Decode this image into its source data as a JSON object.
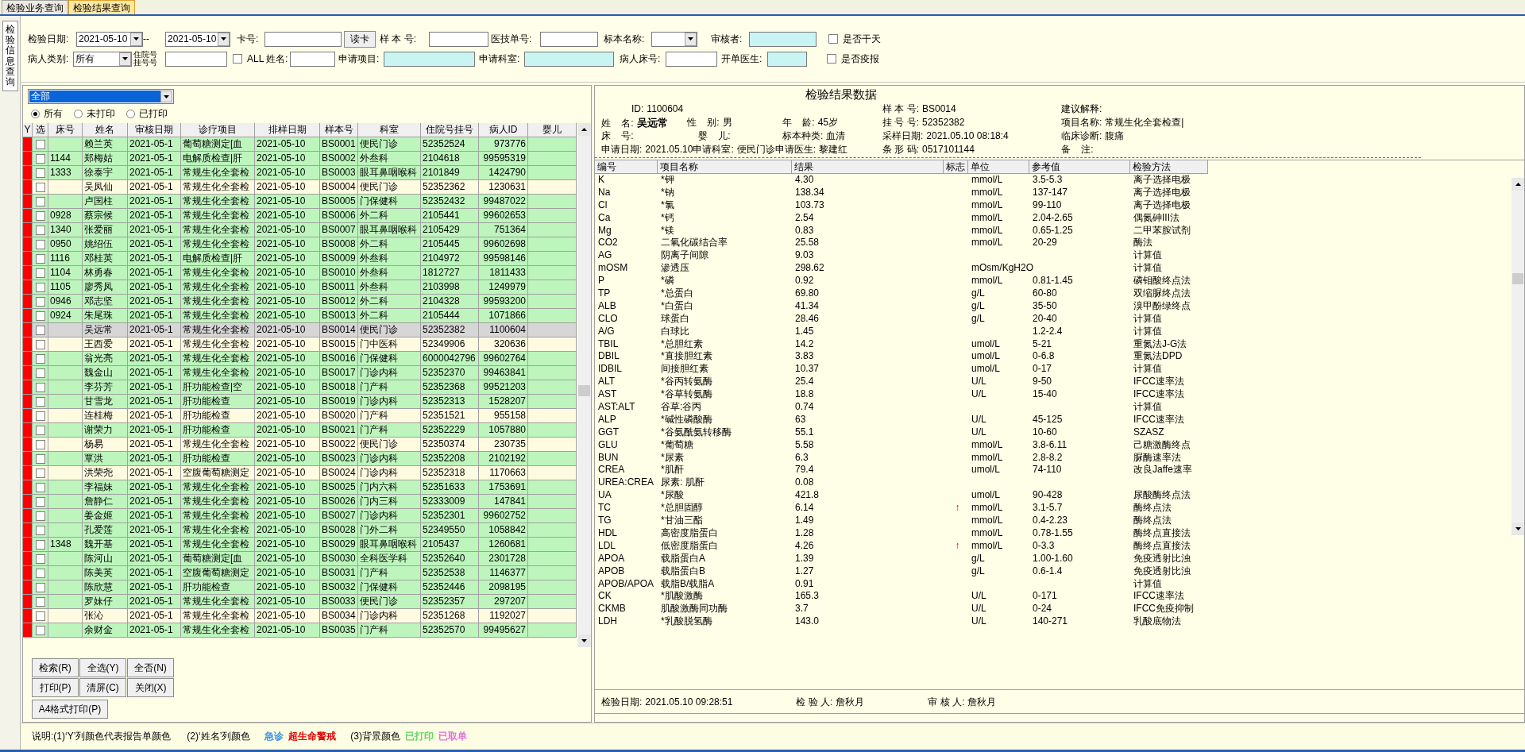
{
  "tabs": [
    {
      "label": "检验业务查询",
      "selected": false
    },
    {
      "label": "检验结果查询",
      "selected": true
    }
  ],
  "side_tab": {
    "label": "检验信息查询",
    "selected": true
  },
  "filters": {
    "row_1": [
      {
        "kind": "label",
        "text": "检验日期:"
      },
      {
        "kind": "dropdown",
        "value": "2021-05-10"
      },
      {
        "kind": "label",
        "text": "--"
      },
      {
        "kind": "dropdown",
        "value": "2021-05-10"
      },
      {
        "kind": "label",
        "text": "卡号:"
      },
      {
        "kind": "input",
        "highlighted": false
      },
      {
        "kind": "button",
        "text": "读卡"
      },
      {
        "kind": "label",
        "text": "样 本 号:"
      },
      {
        "kind": "input",
        "highlighted": false
      },
      {
        "kind": "label",
        "text": "医技单号:"
      },
      {
        "kind": "input",
        "highlighted": false
      },
      {
        "kind": "label",
        "text": "标本名称:"
      },
      {
        "kind": "dropdown"
      },
      {
        "kind": "label",
        "text": "审核者:"
      },
      {
        "kind": "input",
        "highlighted": true
      },
      {
        "kind": "checkbox",
        "text": "是否干天",
        "checked": false
      }
    ],
    "row_2": [
      {
        "kind": "label",
        "text": "病人类别:"
      },
      {
        "kind": "dropdown",
        "value": "所有"
      },
      {
        "kind": "stacked_label",
        "lines": [
          "住院号",
          "挂号号"
        ]
      },
      {
        "kind": "input",
        "highlighted": false
      },
      {
        "kind": "checkbox",
        "text": "ALL",
        "checked": false
      },
      {
        "kind": "label",
        "text": "姓名:"
      },
      {
        "kind": "input",
        "highlighted": false
      },
      {
        "kind": "label",
        "text": "申请项目:"
      },
      {
        "kind": "input",
        "highlighted": true
      },
      {
        "kind": "label",
        "text": "申请科室:"
      },
      {
        "kind": "input",
        "highlighted": true
      },
      {
        "kind": "label",
        "text": "病人床号:"
      },
      {
        "kind": "input",
        "highlighted": false
      },
      {
        "kind": "label",
        "text": "开单医生:"
      },
      {
        "kind": "input",
        "highlighted": true
      },
      {
        "kind": "checkbox",
        "text": "是否疫报",
        "checked": false
      }
    ]
  },
  "list_panel": {
    "filter_dropdown": {
      "value": "全部"
    },
    "print_filter": [
      {
        "label": "所有",
        "selected": true
      },
      {
        "label": "未打印",
        "selected": false
      },
      {
        "label": "已打印",
        "selected": false
      }
    ],
    "columns": [
      "Y",
      "选",
      "床号",
      "姓名",
      "审核日期",
      "诊疗项目",
      "排样日期",
      "样本号",
      "科室",
      "住院号挂号",
      "病人ID",
      "婴儿"
    ],
    "rows": [
      {
        "color": "#ff0000",
        "checked": false,
        "printed": true,
        "selected": false,
        "name": "赖兰英",
        "audit": "2021-05-1",
        "item": "葡萄糖测定[血",
        "sorted": "2021-05-10",
        "sample": "BS0001",
        "dept": "便民门诊",
        "reg": "52352524",
        "pid": "973776"
      },
      {
        "color": "#ff0000",
        "checked": false,
        "printed": true,
        "selected": false,
        "bed": "1144",
        "name": "郑梅姑",
        "audit": "2021-05-1",
        "item": "电解质检查|肝",
        "sorted": "2021-05-10",
        "sample": "BS0002",
        "dept": "外叁科",
        "reg": "2104618",
        "pid": "99595319"
      },
      {
        "color": "#ff0000",
        "checked": false,
        "printed": true,
        "selected": false,
        "bed": "1333",
        "name": "徐泰宇",
        "audit": "2021-05-1",
        "item": "常规生化全套检",
        "sorted": "2021-05-10",
        "sample": "BS0003",
        "dept": "眼耳鼻咽喉科",
        "reg": "2101849",
        "pid": "1424790"
      },
      {
        "color": "#ff0000",
        "checked": false,
        "printed": false,
        "selected": false,
        "name": "吴凤仙",
        "audit": "2021-05-1",
        "item": "常规生化全套检",
        "sorted": "2021-05-10",
        "sample": "BS0004",
        "dept": "便民门诊",
        "reg": "52352362",
        "pid": "1230631"
      },
      {
        "color": "#ff0000",
        "checked": false,
        "printed": true,
        "selected": false,
        "name": "卢国柱",
        "audit": "2021-05-1",
        "item": "常规生化全套检",
        "sorted": "2021-05-10",
        "sample": "BS0005",
        "dept": "门保健科",
        "reg": "52352432",
        "pid": "99487022"
      },
      {
        "color": "#ff0000",
        "checked": false,
        "printed": true,
        "selected": false,
        "bed": "0928",
        "name": "蔡宗候",
        "audit": "2021-05-1",
        "item": "常规生化全套检",
        "sorted": "2021-05-10",
        "sample": "BS0006",
        "dept": "外二科",
        "reg": "2105441",
        "pid": "99602653"
      },
      {
        "color": "#ff0000",
        "checked": false,
        "printed": true,
        "selected": false,
        "bed": "1340",
        "name": "张爱丽",
        "audit": "2021-05-1",
        "item": "常规生化全套检",
        "sorted": "2021-05-10",
        "sample": "BS0007",
        "dept": "眼耳鼻咽喉科",
        "reg": "2105429",
        "pid": "751364"
      },
      {
        "color": "#ff0000",
        "checked": false,
        "printed": true,
        "selected": false,
        "bed": "0950",
        "name": "姚绍伍",
        "audit": "2021-05-1",
        "item": "常规生化全套检",
        "sorted": "2021-05-10",
        "sample": "BS0008",
        "dept": "外二科",
        "reg": "2105445",
        "pid": "99602698"
      },
      {
        "color": "#ff0000",
        "checked": false,
        "printed": true,
        "selected": false,
        "bed": "1116",
        "name": "邓桂英",
        "audit": "2021-05-1",
        "item": "电解质检查|肝",
        "sorted": "2021-05-10",
        "sample": "BS0009",
        "dept": "外叁科",
        "reg": "2104972",
        "pid": "99598146"
      },
      {
        "color": "#ff0000",
        "checked": false,
        "printed": true,
        "selected": false,
        "bed": "1104",
        "name": "林勇春",
        "audit": "2021-05-1",
        "item": "常规生化全套检",
        "sorted": "2021-05-10",
        "sample": "BS0010",
        "dept": "外叁科",
        "reg": "1812727",
        "pid": "1811433"
      },
      {
        "color": "#ff0000",
        "checked": false,
        "printed": true,
        "selected": false,
        "bed": "1105",
        "name": "廖秀凤",
        "audit": "2021-05-1",
        "item": "常规生化全套检",
        "sorted": "2021-05-10",
        "sample": "BS0011",
        "dept": "外叁科",
        "reg": "2103998",
        "pid": "1249979"
      },
      {
        "color": "#ff0000",
        "checked": false,
        "printed": true,
        "selected": false,
        "bed": "0946",
        "name": "邓志坚",
        "audit": "2021-05-1",
        "item": "常规生化全套检",
        "sorted": "2021-05-10",
        "sample": "BS0012",
        "dept": "外二科",
        "reg": "2104328",
        "pid": "99593200"
      },
      {
        "color": "#ff0000",
        "checked": false,
        "printed": true,
        "selected": false,
        "bed": "0924",
        "name": "朱尾珠",
        "audit": "2021-05-1",
        "item": "常规生化全套检",
        "sorted": "2021-05-10",
        "sample": "BS0013",
        "dept": "外二科",
        "reg": "2105444",
        "pid": "1071866"
      },
      {
        "color": "#ff0000",
        "checked": false,
        "selected": true,
        "name": "吴远常",
        "audit": "2021-05-1",
        "item": "常规生化全套检",
        "sorted": "2021-05-10",
        "sample": "BS0014",
        "dept": "便民门诊",
        "reg": "52352382",
        "pid": "1100604"
      },
      {
        "color": "#ff0000",
        "checked": false,
        "printed": false,
        "selected": false,
        "name": "王西爱",
        "audit": "2021-05-1",
        "item": "常规生化全套检",
        "sorted": "2021-05-10",
        "sample": "BS0015",
        "dept": "门中医科",
        "reg": "52349906",
        "pid": "320636"
      },
      {
        "color": "#ff0000",
        "checked": false,
        "printed": true,
        "selected": false,
        "name": "翁光亮",
        "audit": "2021-05-1",
        "item": "常规生化全套检",
        "sorted": "2021-05-10",
        "sample": "BS0016",
        "dept": "门保健科",
        "reg": "6000042796",
        "pid": "99602764"
      },
      {
        "color": "#ff0000",
        "checked": false,
        "printed": true,
        "selected": false,
        "name": "魏金山",
        "audit": "2021-05-1",
        "item": "常规生化全套检",
        "sorted": "2021-05-10",
        "sample": "BS0017",
        "dept": "门诊内科",
        "reg": "52352370",
        "pid": "99463841"
      },
      {
        "color": "#ff0000",
        "checked": false,
        "printed": true,
        "selected": false,
        "name": "李芬芳",
        "audit": "2021-05-1",
        "item": "肝功能检查|空",
        "sorted": "2021-05-10",
        "sample": "BS0018",
        "dept": "门产科",
        "reg": "52352368",
        "pid": "99521203"
      },
      {
        "color": "#ff0000",
        "checked": false,
        "printed": true,
        "selected": false,
        "name": "甘雪龙",
        "audit": "2021-05-1",
        "item": "肝功能检查",
        "sorted": "2021-05-10",
        "sample": "BS0019",
        "dept": "门诊内科",
        "reg": "52352313",
        "pid": "1528207"
      },
      {
        "color": "#ff0000",
        "checked": false,
        "printed": false,
        "selected": false,
        "name": "连桂梅",
        "audit": "2021-05-1",
        "item": "肝功能检查",
        "sorted": "2021-05-10",
        "sample": "BS0020",
        "dept": "门产科",
        "reg": "52351521",
        "pid": "955158"
      },
      {
        "color": "#ff0000",
        "checked": false,
        "printed": true,
        "selected": false,
        "name": "谢荣力",
        "audit": "2021-05-1",
        "item": "肝功能检查",
        "sorted": "2021-05-10",
        "sample": "BS0021",
        "dept": "门产科",
        "reg": "52352229",
        "pid": "1057880"
      },
      {
        "color": "#ff0000",
        "checked": false,
        "printed": false,
        "selected": false,
        "name": "杨易",
        "audit": "2021-05-1",
        "item": "常规生化全套检",
        "sorted": "2021-05-10",
        "sample": "BS0022",
        "dept": "便民门诊",
        "reg": "52350374",
        "pid": "230735"
      },
      {
        "color": "#ff0000",
        "checked": false,
        "printed": true,
        "selected": false,
        "name": "覃洪",
        "audit": "2021-05-1",
        "item": "肝功能检查",
        "sorted": "2021-05-10",
        "sample": "BS0023",
        "dept": "门诊内科",
        "reg": "52352208",
        "pid": "2102192"
      },
      {
        "color": "#ff0000",
        "checked": false,
        "printed": false,
        "selected": false,
        "name": "洪荣尧",
        "audit": "2021-05-1",
        "item": "空腹葡萄糖测定",
        "sorted": "2021-05-10",
        "sample": "BS0024",
        "dept": "门诊内科",
        "reg": "52352318",
        "pid": "1170663"
      },
      {
        "color": "#ff0000",
        "checked": false,
        "printed": true,
        "selected": false,
        "name": "李福妹",
        "audit": "2021-05-1",
        "item": "常规生化全套检",
        "sorted": "2021-05-10",
        "sample": "BS0025",
        "dept": "门内六科",
        "reg": "52351633",
        "pid": "1753691"
      },
      {
        "color": "#ff0000",
        "checked": false,
        "printed": true,
        "selected": false,
        "name": "詹静仁",
        "audit": "2021-05-1",
        "item": "常规生化全套检",
        "sorted": "2021-05-10",
        "sample": "BS0026",
        "dept": "门内三科",
        "reg": "52333009",
        "pid": "147841"
      },
      {
        "color": "#ff0000",
        "checked": false,
        "printed": true,
        "selected": false,
        "name": "姜金姬",
        "audit": "2021-05-1",
        "item": "常规生化全套检",
        "sorted": "2021-05-10",
        "sample": "BS0027",
        "dept": "门诊内科",
        "reg": "52352301",
        "pid": "99602752"
      },
      {
        "color": "#ff0000",
        "checked": false,
        "printed": true,
        "selected": false,
        "name": "孔爱莲",
        "audit": "2021-05-1",
        "item": "常规生化全套检",
        "sorted": "2021-05-10",
        "sample": "BS0028",
        "dept": "门外二科",
        "reg": "52349550",
        "pid": "1058842"
      },
      {
        "color": "#ff0000",
        "checked": false,
        "printed": true,
        "selected": false,
        "bed": "1348",
        "name": "魏开基",
        "audit": "2021-05-1",
        "item": "常规生化全套检",
        "sorted": "2021-05-10",
        "sample": "BS0029",
        "dept": "眼耳鼻咽喉科",
        "reg": "2105437",
        "pid": "1260681"
      },
      {
        "color": "#ff0000",
        "checked": false,
        "printed": true,
        "selected": false,
        "name": "陈河山",
        "audit": "2021-05-1",
        "item": "葡萄糖测定[血",
        "sorted": "2021-05-10",
        "sample": "BS0030",
        "dept": "全科医学科",
        "reg": "52352640",
        "pid": "2301728"
      },
      {
        "color": "#ff0000",
        "checked": false,
        "printed": true,
        "selected": false,
        "name": "陈美英",
        "audit": "2021-05-1",
        "item": "空腹葡萄糖测定",
        "sorted": "2021-05-10",
        "sample": "BS0031",
        "dept": "门产科",
        "reg": "52352538",
        "pid": "1146377"
      },
      {
        "color": "#ff0000",
        "checked": false,
        "printed": true,
        "selected": false,
        "name": "陈欣慧",
        "audit": "2021-05-1",
        "item": "肝功能检查",
        "sorted": "2021-05-10",
        "sample": "BS0032",
        "dept": "门保健科",
        "reg": "52352446",
        "pid": "2098195"
      },
      {
        "color": "#ff0000",
        "checked": false,
        "printed": true,
        "selected": false,
        "name": "罗妹仔",
        "audit": "2021-05-1",
        "item": "常规生化全套检",
        "sorted": "2021-05-10",
        "sample": "BS0033",
        "dept": "便民门诊",
        "reg": "52352357",
        "pid": "297207"
      },
      {
        "color": "#ff0000",
        "checked": false,
        "printed": false,
        "selected": false,
        "name": "张沁",
        "audit": "2021-05-1",
        "item": "常规生化全套检",
        "sorted": "2021-05-10",
        "sample": "BS0034",
        "dept": "门诊内科",
        "reg": "52351268",
        "pid": "1192027"
      },
      {
        "color": "#ff0000",
        "checked": false,
        "printed": true,
        "selected": false,
        "name": "余财金",
        "audit": "2021-05-1",
        "item": "常规生化全套检",
        "sorted": "2021-05-10",
        "sample": "BS0035",
        "dept": "门产科",
        "reg": "52352570",
        "pid": "99495627"
      }
    ],
    "buttons": [
      "检索(R)",
      "全选(Y)",
      "全否(N)",
      "打印(P)",
      "清屏(C)",
      "关闭(X)",
      "A4格式打印(P)"
    ]
  },
  "legend": [
    {
      "text": "说明:(1)‘Y’列颜色代表报告单颜色"
    },
    {
      "text": "(2)‘姓名’列颜色"
    },
    {
      "text": "急诊",
      "color": "#3a8ee6"
    },
    {
      "text": "超生命警戒",
      "color": "#e00000"
    },
    {
      "text": "(3)背景颜色"
    },
    {
      "text": "已打印",
      "color": "#5ed85e"
    },
    {
      "text": "已取单",
      "color": "#e070e0"
    }
  ],
  "result_panel": {
    "title": "检验结果数据",
    "info_left": [
      [
        {
          "label": "ID:",
          "value": "1100604"
        }
      ],
      [
        {
          "label": "姓    名:",
          "value": "吴远常"
        },
        {
          "label": "性    别:",
          "value": "男"
        },
        {
          "label": "年    龄:",
          "value": "45岁"
        }
      ],
      [
        {
          "label": "床    号:"
        },
        {
          "label": "婴    儿:"
        },
        {
          "label": "标本种类:",
          "value": "血清"
        }
      ],
      [
        {
          "label": "申请日期:",
          "value": "2021.05.10"
        },
        {
          "label": "申请科室:",
          "value": "便民门诊"
        },
        {
          "label": "申请医生:",
          "value": "黎建红"
        }
      ]
    ],
    "info_middle": [
      {
        "label": "样 本 号:",
        "value": "BS0014"
      },
      {
        "label": "挂 号 号:",
        "value": "52352382"
      },
      {
        "label": "采样日期:",
        "value": "2021.05.10 08:18:4"
      },
      {
        "label": "条 形 码:",
        "value": "0517101144"
      }
    ],
    "info_right": [
      {
        "label": "建议解释:"
      },
      {
        "label": "项目名称:",
        "value": "常规生化全套检查|"
      },
      {
        "label": "临床诊断:",
        "value": "腹痛"
      },
      {
        "label": "备    注:"
      }
    ],
    "columns": [
      "编号",
      "项目名称",
      "结果",
      "标志",
      "单位",
      "参考值",
      "检验方法"
    ],
    "rows": [
      {
        "code": "K",
        "name": "*钾",
        "result": "4.30",
        "unit": "mmol/L",
        "ref": "3.5-5.3",
        "method": "离子选择电极"
      },
      {
        "code": "Na",
        "name": "*钠",
        "result": "138.34",
        "unit": "mmol/L",
        "ref": "137-147",
        "method": "离子选择电极"
      },
      {
        "code": "Cl",
        "name": "*氯",
        "result": "103.73",
        "unit": "mmol/L",
        "ref": "99-110",
        "method": "离子选择电极"
      },
      {
        "code": "Ca",
        "name": "*钙",
        "result": "2.54",
        "unit": "mmol/L",
        "ref": "2.04-2.65",
        "method": "偶氮砷III法"
      },
      {
        "code": "Mg",
        "name": "*镁",
        "result": "0.83",
        "unit": "mmol/L",
        "ref": "0.65-1.25",
        "method": "二甲苯胺试剂"
      },
      {
        "code": "CO2",
        "name": "二氧化碳结合率",
        "result": "25.58",
        "unit": "mmol/L",
        "ref": "20-29",
        "method": "酶法"
      },
      {
        "code": "AG",
        "name": "阴离子间隙",
        "result": "9.03",
        "method": "计算值"
      },
      {
        "code": "mOSM",
        "name": "渗透压",
        "result": "298.62",
        "unit": "mOsm/KgH2O",
        "method": "计算值"
      },
      {
        "code": "P",
        "name": "*磷",
        "result": "0.92",
        "unit": "mmol/L",
        "ref": "0.81-1.45",
        "method": "磷钼酸终点法"
      },
      {
        "code": "TP",
        "name": "*总蛋白",
        "result": "69.80",
        "unit": "g/L",
        "ref": "60-80",
        "method": "双缩脲终点法"
      },
      {
        "code": "ALB",
        "name": "*白蛋白",
        "result": "41.34",
        "unit": "g/L",
        "ref": "35-50",
        "method": "溴甲酚绿终点"
      },
      {
        "code": "CLO",
        "name": "球蛋白",
        "result": "28.46",
        "unit": "g/L",
        "ref": "20-40",
        "method": "计算值"
      },
      {
        "code": "A/G",
        "name": "白球比",
        "result": "1.45",
        "ref": "1.2-2.4",
        "method": "计算值"
      },
      {
        "code": "TBIL",
        "name": "*总胆红素",
        "result": "14.2",
        "unit": "umol/L",
        "ref": "5-21",
        "method": "重氮法J-G法"
      },
      {
        "code": "DBIL",
        "name": "*直接胆红素",
        "result": "3.83",
        "unit": "umol/L",
        "ref": "0-6.8",
        "method": "重氮法DPD"
      },
      {
        "code": "IDBIL",
        "name": "间接胆红素",
        "result": "10.37",
        "unit": "umol/L",
        "ref": "0-17",
        "method": "计算值"
      },
      {
        "code": "ALT",
        "name": "*谷丙转氨酶",
        "result": "25.4",
        "unit": "U/L",
        "ref": "9-50",
        "method": "IFCC速率法"
      },
      {
        "code": "AST",
        "name": "*谷草转氨酶",
        "result": "18.8",
        "unit": "U/L",
        "ref": "15-40",
        "method": "IFCC速率法"
      },
      {
        "code": "AST:ALT",
        "name": "谷草:谷丙",
        "result": "0.74",
        "method": "计算值"
      },
      {
        "code": "ALP",
        "name": "*碱性磷酸酶",
        "result": "63",
        "unit": "U/L",
        "ref": "45-125",
        "method": "IFCC速率法"
      },
      {
        "code": "GGT",
        "name": "*谷氨酰氨转移酶",
        "result": "55.1",
        "unit": "U/L",
        "ref": "10-60",
        "method": "SZASZ"
      },
      {
        "code": "GLU",
        "name": "*葡萄糖",
        "result": "5.58",
        "unit": "mmol/L",
        "ref": "3.8-6.11",
        "method": "己糖激酶终点"
      },
      {
        "code": "BUN",
        "name": "*尿素",
        "result": "6.3",
        "unit": "mmol/L",
        "ref": "2.8-8.2",
        "method": "脲酶速率法"
      },
      {
        "code": "CREA",
        "name": "*肌酐",
        "result": "79.4",
        "unit": "umol/L",
        "ref": "74-110",
        "method": "改良Jaffe速率"
      },
      {
        "code": "UREA:CREA",
        "name": "尿素: 肌酐",
        "result": "0.08"
      },
      {
        "code": "UA",
        "name": "*尿酸",
        "result": "421.8",
        "unit": "umol/L",
        "ref": "90-428",
        "method": "尿酸酶终点法"
      },
      {
        "code": "TC",
        "name": "*总胆固醇",
        "result": "6.14",
        "flag": "↑",
        "unit": "mmol/L",
        "ref": "3.1-5.7",
        "method": "酶终点法"
      },
      {
        "code": "TG",
        "name": "*甘油三酯",
        "result": "1.49",
        "unit": "mmol/L",
        "ref": "0.4-2.23",
        "method": "酶终点法"
      },
      {
        "code": "HDL",
        "name": "高密度脂蛋白",
        "result": "1.28",
        "unit": "mmol/L",
        "ref": "0.78-1.55",
        "method": "酶终点直接法"
      },
      {
        "code": "LDL",
        "name": "低密度脂蛋白",
        "result": "4.26",
        "flag": "↑",
        "unit": "mmol/L",
        "ref": "0-3.3",
        "method": "酶终点直接法"
      },
      {
        "code": "APOA",
        "name": "载脂蛋白A",
        "result": "1.39",
        "unit": "g/L",
        "ref": "1.00-1.60",
        "method": "免疫透射比浊"
      },
      {
        "code": "APOB",
        "name": "载脂蛋白B",
        "result": "1.27",
        "unit": "g/L",
        "ref": "0.6-1.4",
        "method": "免疫透射比浊"
      },
      {
        "code": "APOB/APOA",
        "name": "载脂B/载脂A",
        "result": "0.91",
        "method": "计算值"
      },
      {
        "code": "CK",
        "name": "*肌酸激酶",
        "result": "165.3",
        "unit": "U/L",
        "ref": "0-171",
        "method": "IFCC速率法"
      },
      {
        "code": "CKMB",
        "name": "肌酸激酶同功酶",
        "result": "3.7",
        "unit": "U/L",
        "ref": "0-24",
        "method": "IFCC免疫抑制"
      },
      {
        "code": "LDH",
        "name": "*乳酸脱氢酶",
        "result": "143.0",
        "unit": "U/L",
        "ref": "140-271",
        "method": "乳酸底物法"
      }
    ],
    "footer": [
      {
        "label": "检验日期:",
        "value": "2021.05.10 09:28:51"
      },
      {
        "label": "检 验 人:",
        "value": "詹秋月"
      },
      {
        "label": "审 核 人:",
        "value": "詹秋月"
      }
    ]
  }
}
